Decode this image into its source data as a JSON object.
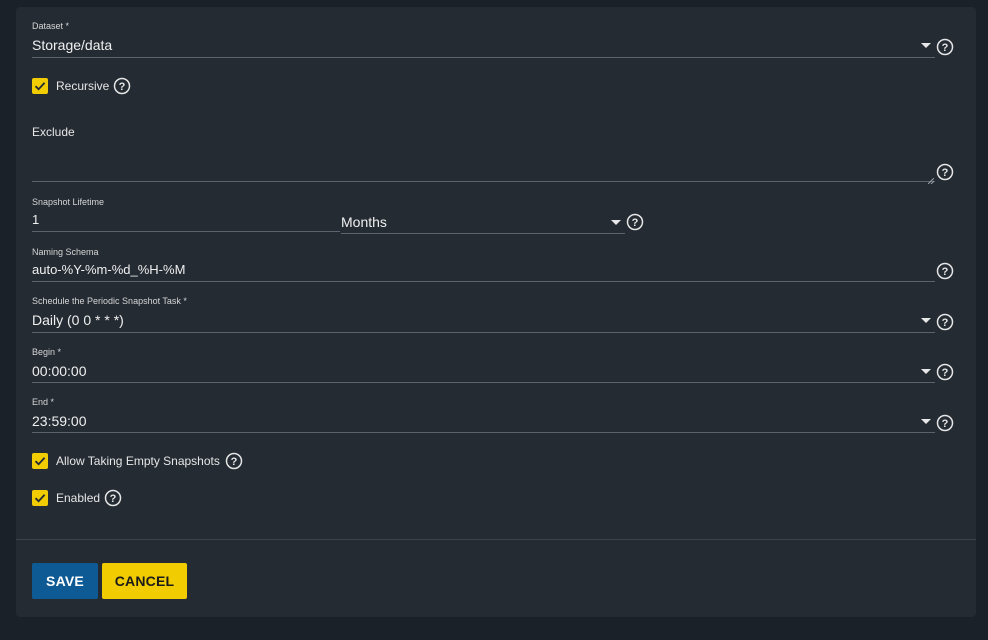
{
  "form": {
    "dataset": {
      "label": "Dataset *",
      "value": "Storage/data"
    },
    "recursive": {
      "label": "Recursive",
      "checked": true
    },
    "exclude": {
      "label": "Exclude",
      "value": ""
    },
    "snapshot_lifetime": {
      "label": "Snapshot Lifetime",
      "value": "1",
      "unit": "Months"
    },
    "naming_schema": {
      "label": "Naming Schema",
      "value": "auto-%Y-%m-%d_%H-%M"
    },
    "schedule": {
      "label": "Schedule the Periodic Snapshot Task *",
      "value": "Daily (0 0 * * *)"
    },
    "begin": {
      "label": "Begin *",
      "value": "00:00:00"
    },
    "end": {
      "label": "End *",
      "value": "23:59:00"
    },
    "allow_empty": {
      "label": "Allow Taking Empty Snapshots",
      "checked": true
    },
    "enabled": {
      "label": "Enabled",
      "checked": true
    }
  },
  "actions": {
    "save_label": "SAVE",
    "cancel_label": "CANCEL"
  },
  "colors": {
    "background": "#1a2128",
    "card": "#242b33",
    "accent_yellow": "#f0cc00",
    "save_blue": "#0e5a94"
  },
  "icons": {
    "help": "help-circle-icon",
    "dropdown": "caret-down-icon",
    "check": "check-icon"
  }
}
